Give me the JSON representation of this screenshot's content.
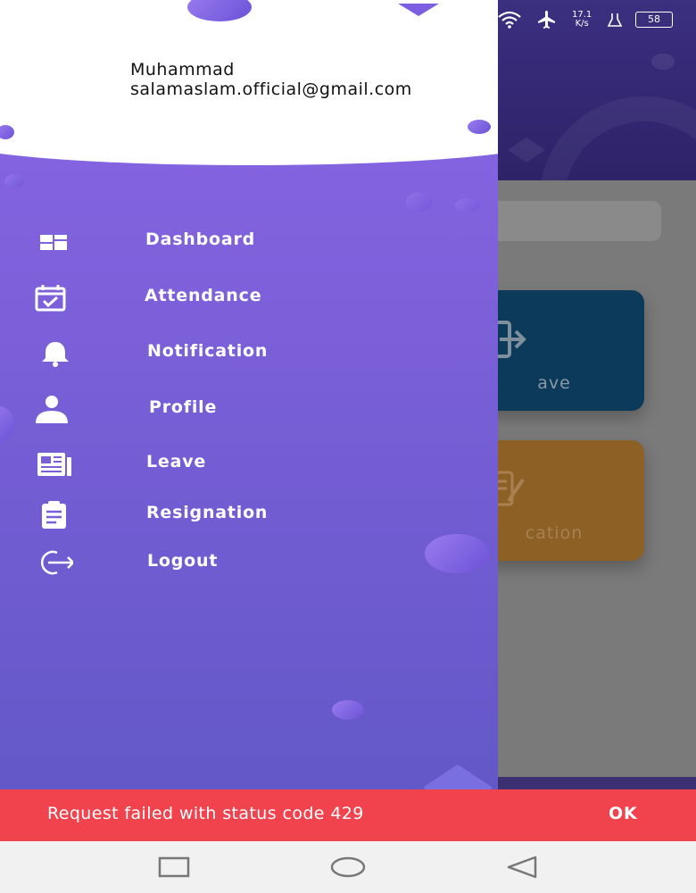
{
  "status_bar": {
    "net_speed": "17.1",
    "net_unit": "K/s",
    "battery": "58",
    "icons": [
      "wifi-icon",
      "airplane-icon",
      "alarm-icon",
      "battery-icon"
    ]
  },
  "drawer": {
    "user_name": "Muhammad",
    "user_email": "salamaslam.official@gmail.com",
    "items": [
      {
        "label": "Dashboard",
        "icon": "dashboard-icon"
      },
      {
        "label": "Attendance",
        "icon": "calendar-check-icon"
      },
      {
        "label": "Notification",
        "icon": "bell-icon"
      },
      {
        "label": "Profile",
        "icon": "user-icon"
      },
      {
        "label": "Leave",
        "icon": "newspaper-icon"
      },
      {
        "label": "Resignation",
        "icon": "clipboard-icon"
      },
      {
        "label": "Logout",
        "icon": "logout-icon"
      }
    ]
  },
  "background": {
    "card_leave_label": "ave",
    "card_resignation_label": "cation"
  },
  "snackbar": {
    "message": "Request failed with status code 429",
    "action": "OK"
  },
  "colors": {
    "drawer_top": "#8b66e6",
    "drawer_bottom": "#6358c8",
    "snackbar": "#f0434e",
    "card_leave": "#0c3a5a",
    "card_resignation": "#8d6026"
  }
}
